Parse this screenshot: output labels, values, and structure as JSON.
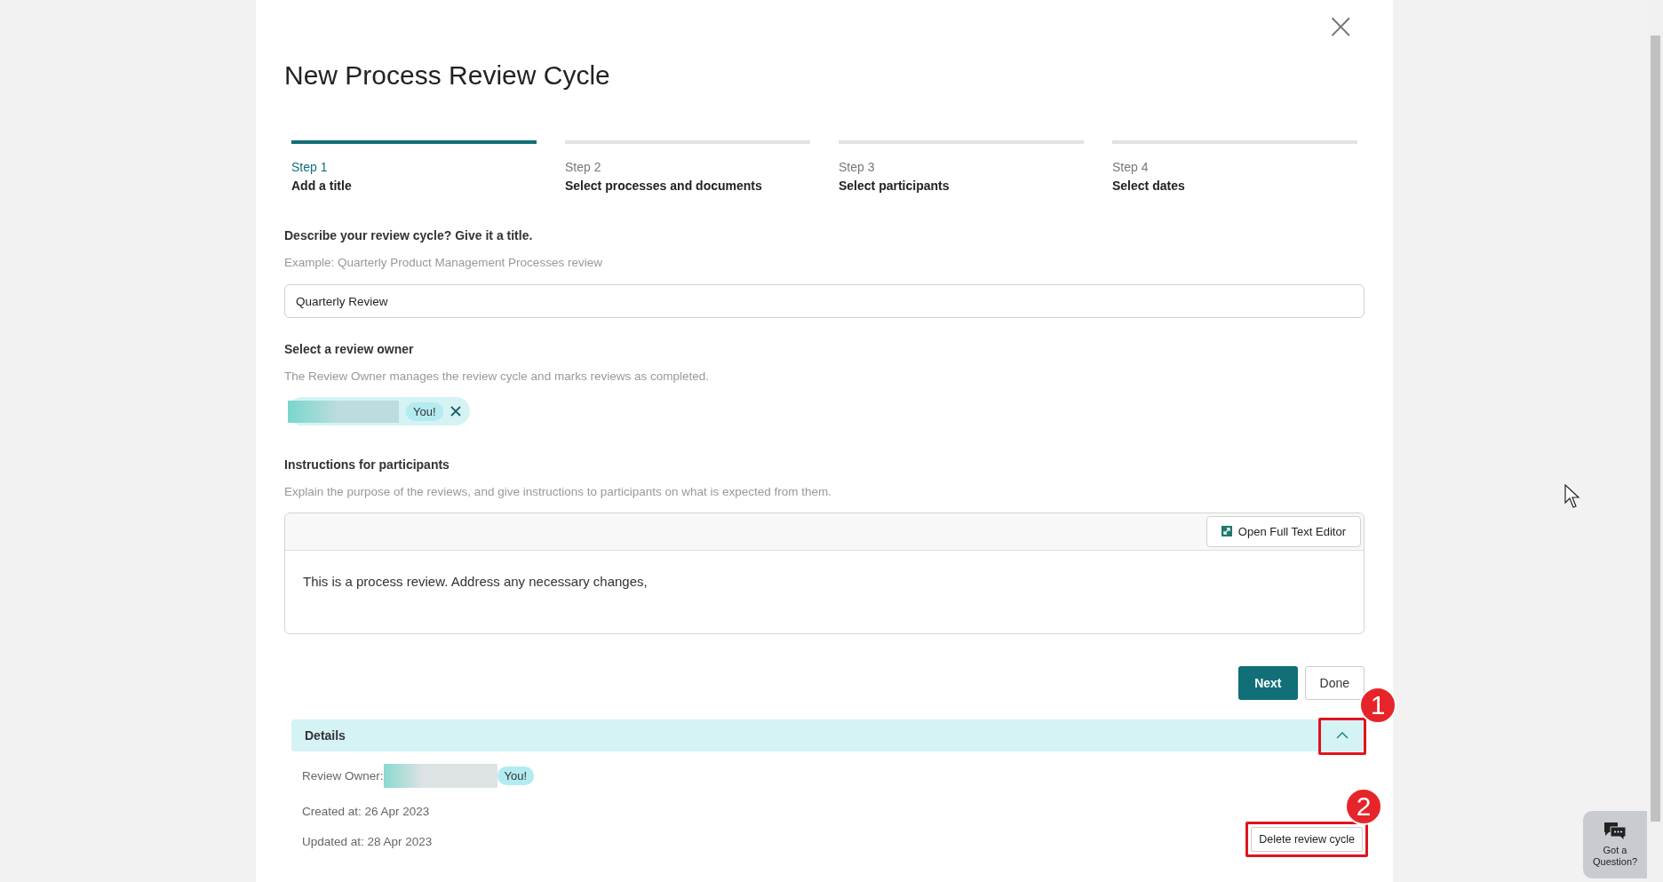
{
  "dialog": {
    "title": "New Process Review Cycle",
    "close_icon": "×"
  },
  "steps": [
    {
      "step": "Step 1",
      "label": "Add a title",
      "selected": true
    },
    {
      "step": "Step 2",
      "label": "Select processes and documents",
      "selected": false
    },
    {
      "step": "Step 3",
      "label": "Select participants",
      "selected": false
    },
    {
      "step": "Step 4",
      "label": "Select dates",
      "selected": false
    }
  ],
  "title_field": {
    "label": "Describe your review cycle? Give it a title.",
    "hint": "Example: Quarterly Product Management Processes review",
    "value": "Quarterly Review"
  },
  "owner": {
    "label": "Select a review owner",
    "hint": "The Review Owner manages the review cycle and marks reviews as completed.",
    "badge": "You!"
  },
  "instructions": {
    "label": "Instructions for participants",
    "hint": "Explain the purpose of the reviews, and give instructions to participants on what is expected from them.",
    "editor_button": "Open Full Text Editor",
    "text": "This is a process review. Address any necessary changes,"
  },
  "buttons": {
    "next": "Next",
    "done": "Done"
  },
  "details": {
    "title": "Details",
    "expanded": true,
    "owner_label": "Review Owner:",
    "owner_badge": "You!",
    "created": "Created at: 26 Apr 2023",
    "updated": "Updated at: 28 Apr 2023",
    "delete_button": "Delete review cycle"
  },
  "annotations": [
    {
      "number": "1"
    },
    {
      "number": "2"
    }
  ],
  "help_widget": {
    "label": "Got a Question?"
  }
}
